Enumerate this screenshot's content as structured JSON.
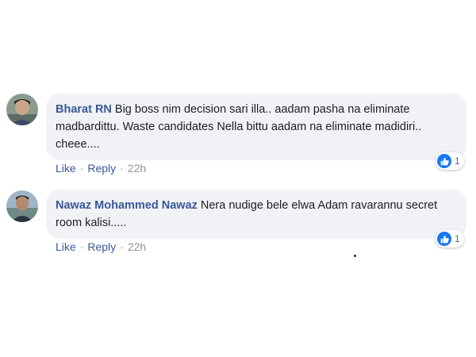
{
  "comments": [
    {
      "author": "Bharat RN",
      "text": "Big boss nim decision sari illa.. aadam pasha na eliminate madbardittu. Waste candidates Nella bittu aadam na eliminate madidiri.. cheee....",
      "reaction_count": "1",
      "actions": {
        "like": "Like",
        "reply": "Reply",
        "time": "22h"
      }
    },
    {
      "author": "Nawaz Mohammed Nawaz",
      "text": "Nera nudige bele elwa Adam ravarannu secret room kalisi.....",
      "reaction_count": "1",
      "actions": {
        "like": "Like",
        "reply": "Reply",
        "time": "22h"
      }
    }
  ],
  "colors": {
    "author_link": "#385898",
    "bubble_bg": "#f1f2f6",
    "like_badge": "#1877f2"
  },
  "icons": {
    "reaction": "thumbs-up-icon",
    "avatar": "avatar"
  }
}
